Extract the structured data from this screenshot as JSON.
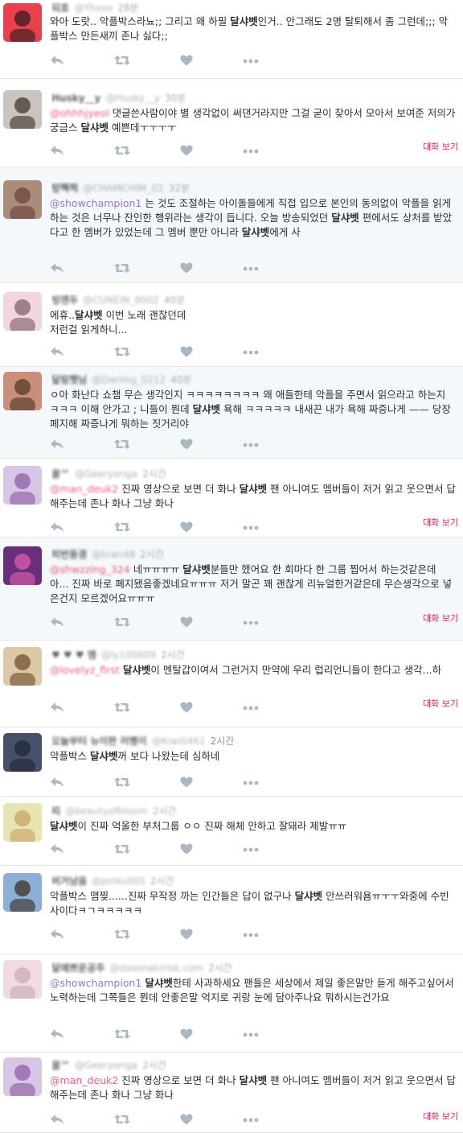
{
  "tweets": [
    {
      "id": "t1",
      "name": "되호",
      "handle": "@Yhxxx",
      "time": "28분",
      "mention": "",
      "segments": [
        [
          "와아 도랏.. 악플박스라뇨;; 그리고 왜 하필 ",
          false
        ],
        [
          "달샤벳",
          true
        ],
        [
          "인거.. 안그래도 2명 탈퇴해서 좀 그런데;;; 악플박스 만든새끼 존나 싫다;;",
          false
        ]
      ],
      "convo": ""
    },
    {
      "id": "t2",
      "name": "Husky__y",
      "handle": "@Husky__y",
      "time": "30분",
      "mention": "@ohhhjyeol",
      "segments": [
        [
          " 댓글쓴사람이야 별 생각없이 써댄거라지만 그걸 굳이 찾아서 모아서 보여준 저의가 궁금스 ",
          false
        ],
        [
          "달샤벳",
          true
        ],
        [
          " 예쁜데ㅜㅜㅜㅜ",
          false
        ]
      ],
      "convo": "대화 보기"
    },
    {
      "id": "t3",
      "name": "탕쨱찍",
      "handle": "@CHAMCHIM_02",
      "time": "32분",
      "mention": "@showchampion1",
      "segments": [
        [
          " 는 것도 조절하는 아이돌들에게 직접 입으로 본인의 동의없이 악플을 읽게 하는 것은 너무나 잔인한 행위라는 생각이 듭니다. 오늘 방송되었던 ",
          false
        ],
        [
          "달샤벳",
          true
        ],
        [
          " 편에서도 상처를 받았다고 한 멤버가 있었는데 그 멤버 뿐만 아니라 ",
          false
        ],
        [
          "달샤벳",
          true
        ],
        [
          "에게 사",
          false
        ]
      ],
      "convo": ""
    },
    {
      "id": "t4",
      "name": "빙엔두",
      "handle": "@CUNEIN_8002",
      "time": "40분",
      "mention": "",
      "segments": [
        [
          "에휴..",
          false
        ],
        [
          "달샤벳",
          true
        ],
        [
          " 이번 노래 괜찮던데\n저런걸 읽게하니...",
          false
        ]
      ],
      "convo": ""
    },
    {
      "id": "t5",
      "name": "달링햇님",
      "handle": "@Darling_0212",
      "time": "40분",
      "mention": "",
      "segments": [
        [
          "ㅇ아 화난다 쇼챔 무슨 생각인지 ㅋㅋㅋㅋㅋㅋㅋㅋ 왜 애들한테 악플을 주면서 읽으라고 하는지 ㅋㅋㅋ 이해 안가고 ; 니들이 뭔데 ",
          false
        ],
        [
          "달샤벳",
          true
        ],
        [
          " 욕해 ㅋㅋㅋㅋㅋ 내새끈 내가 욕해 짜증나게 —— 당장 폐지해 짜증나게 뭐하는 짓거리야",
          false
        ]
      ],
      "convo": ""
    },
    {
      "id": "t6",
      "name": "꿀™",
      "handle": "@Geeryonga",
      "time": "2시간",
      "mention": "@man_deuk2",
      "segments": [
        [
          " 진짜 영상으로 보면 더 화나 ",
          false
        ],
        [
          "달샤벳",
          true
        ],
        [
          " 팬 아니여도 멤버들이 저거 읽고 웃으면서 답해주는데 존나 화나 그냥 화나",
          false
        ]
      ],
      "convo": "대화 보기"
    },
    {
      "id": "t7",
      "name": "피번동경",
      "handle": "@kran48",
      "time": "2시간",
      "mention": "@shwzzing_324",
      "segments": [
        [
          " 네ㅠㅠㅠㅠ ",
          false
        ],
        [
          "달샤벳",
          true
        ],
        [
          "분들만 했어요 한 회마다 한 그룹 찝어서 하는것같은데 아... 진짜 바로 폐지됐음좋겠네요ㅠㅠㅠ 저거 말곤 꽤 괜찮게 리뉴얼한거같은데 무슨생각으로 넣은건지 모르겠어요ㅠㅠㅠ",
          false
        ]
      ],
      "convo": "대화 보기"
    },
    {
      "id": "t8",
      "name": "♥ ♥ ♥ 엠",
      "handle": "@ly100609",
      "time": "2시간",
      "mention": "@lovelyz_first",
      "segments": [
        [
          " ",
          false
        ],
        [
          "달샤벳",
          true
        ],
        [
          "이 멘탈갑이여서 그런거지 만약에 우리 럽리언니들이 한다고 생각...하",
          false
        ]
      ],
      "convo": "대화 보기"
    },
    {
      "id": "t9",
      "name": "오늘부터 뉴이판 러펭이",
      "handle": "@Kiwi0461",
      "time": "2시간",
      "mention": "",
      "segments": [
        [
          "악플박스 ",
          false
        ],
        [
          "달샤벳",
          true
        ],
        [
          "꺼 보다 나왔는데 심하네",
          false
        ]
      ],
      "convo": ""
    },
    {
      "id": "t10",
      "name": "띠",
      "handle": "@beautyofbloom",
      "time": "2시간",
      "mention": "",
      "segments": [
        [
          "달샤벳",
          true
        ],
        [
          "이 진짜 억울한 부처그룹 ㅇㅇ 진짜 해체 안하고 잘돼라 제발ㅠㅠ",
          false
        ]
      ],
      "convo": ""
    },
    {
      "id": "t11",
      "name": "버거남음",
      "handle": "@pinkull05",
      "time": "2시간",
      "mention": "",
      "segments": [
        [
          "악플박스 맴찢......진짜 무작정 까는 인간들은 답이 없구나 ",
          false
        ],
        [
          "달샤벳",
          true
        ],
        [
          " 안쓰러워욤ㅠㅜㅜ와중에 수빈 사이다ㅋㄱㅋㅋㅋㅋㅋ",
          false
        ]
      ],
      "convo": ""
    },
    {
      "id": "t12",
      "name": "달예쁘운공주",
      "handle": "@dasonakirisk.com",
      "time": "2시간",
      "mention": "@showchampion1",
      "segments": [
        [
          " ",
          false
        ],
        [
          "달샤벳",
          true
        ],
        [
          "한테 사과하세요 팬들은 세상에서 제일 좋은말만 듣게 해주고싶어서 노력하는데 그쪽들은 뭔데 안좋은말 억지로 귀랑 눈에 담아주나요 뭐하시는건가요",
          false
        ]
      ],
      "convo": ""
    },
    {
      "id": "t13",
      "name": "꿀™",
      "handle": "@Geeryonga",
      "time": "2시간",
      "mention": "@man_deuk2",
      "segments": [
        [
          " 진짜 영상으로 보면 더 화나 ",
          false
        ],
        [
          "달샤벳",
          true
        ],
        [
          " 팬 아니여도 멤버들이 저거 읽고 웃으면서 답해주는데 존나 화나 그냥 화나",
          false
        ]
      ],
      "convo": "대화 보기"
    }
  ],
  "colors": {
    "accent_pink": "#e0245e",
    "mention_purple": "#8a7cd1",
    "icon_gray": "#aab8c2",
    "border": "#e1e8ed",
    "shade": "#f5f8fa"
  },
  "icons": {
    "reply": "reply-icon",
    "retweet": "retweet-icon",
    "like": "heart-icon",
    "more": "more-icon"
  }
}
